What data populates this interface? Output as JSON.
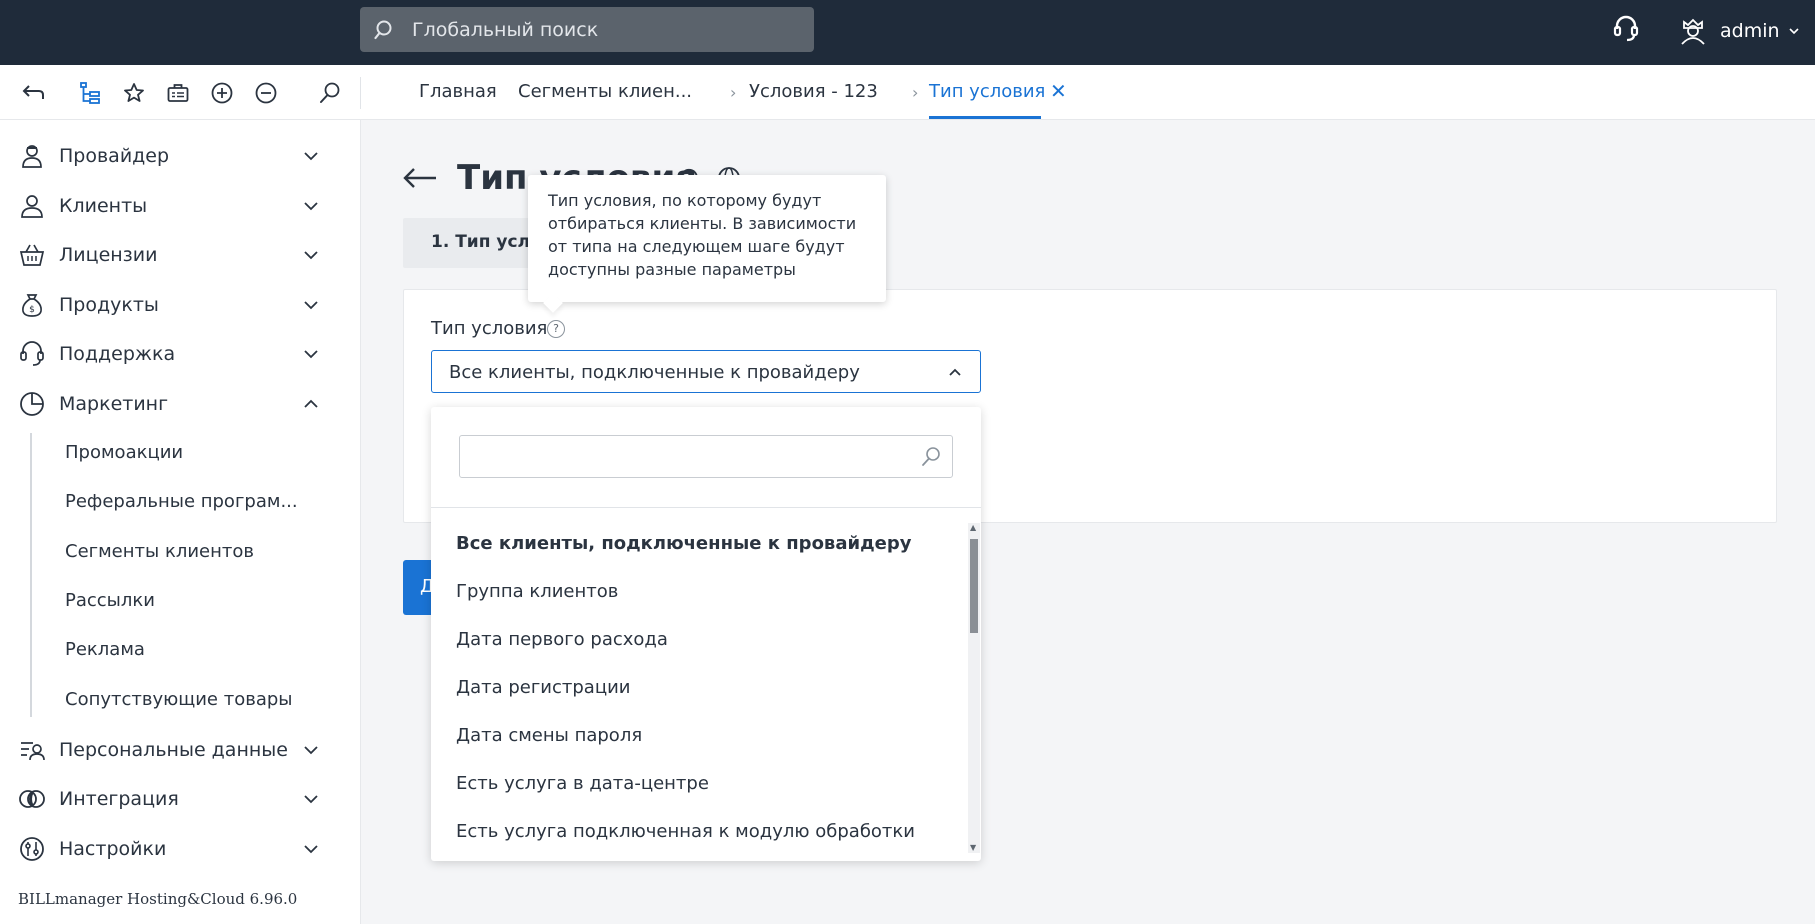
{
  "header": {
    "search_placeholder": "Глобальный поиск",
    "user_name": "admin"
  },
  "breadcrumbs": [
    {
      "label": "Главная"
    },
    {
      "label": "Сегменты клиен..."
    },
    {
      "label": "Условия - 123"
    },
    {
      "label": "Тип условия",
      "active": true
    }
  ],
  "sidebar": {
    "items": [
      {
        "label": "Провайдер",
        "icon": "provider-icon"
      },
      {
        "label": "Клиенты",
        "icon": "clients-icon"
      },
      {
        "label": "Лицензии",
        "icon": "basket-icon"
      },
      {
        "label": "Продукты",
        "icon": "money-bag-icon"
      },
      {
        "label": "Поддержка",
        "icon": "headset-icon"
      },
      {
        "label": "Маркетинг",
        "icon": "pie-chart-icon",
        "expanded": true
      },
      {
        "label": "Персональные данные",
        "icon": "personal-data-icon"
      },
      {
        "label": "Интеграция",
        "icon": "integration-icon"
      },
      {
        "label": "Настройки",
        "icon": "settings-icon"
      }
    ],
    "marketing_subitems": [
      {
        "label": "Промоакции"
      },
      {
        "label": "Реферальные програм..."
      },
      {
        "label": "Сегменты клиентов"
      },
      {
        "label": "Рассылки"
      },
      {
        "label": "Реклама"
      },
      {
        "label": "Сопутствующие товары"
      }
    ],
    "version": "BILLmanager Hosting&Cloud 6.96.0"
  },
  "main": {
    "title": "Тип условия",
    "step_label": "1. Тип услов",
    "field_label": "Тип условия",
    "help_mark": "?",
    "selected_value": "Все клиенты, подключенные к провайдеру",
    "button_label": "Д",
    "tooltip": "Тип условия, по которому будут отбираться клиенты. В зависимости от типа на следующем шаге будут доступны разные параметры"
  },
  "dropdown": {
    "search_value": "",
    "options": [
      {
        "label": "Все клиенты, подключенные к провайдеру",
        "selected": true
      },
      {
        "label": "Группа клиентов"
      },
      {
        "label": "Дата первого расхода"
      },
      {
        "label": "Дата регистрации"
      },
      {
        "label": "Дата смены пароля"
      },
      {
        "label": "Есть услуга в дата-центре"
      },
      {
        "label": "Есть услуга подключенная к модулю обработки"
      }
    ]
  },
  "colors": {
    "topbar": "#1f2b3a",
    "accent": "#1a73d4",
    "text": "#2b3440"
  }
}
